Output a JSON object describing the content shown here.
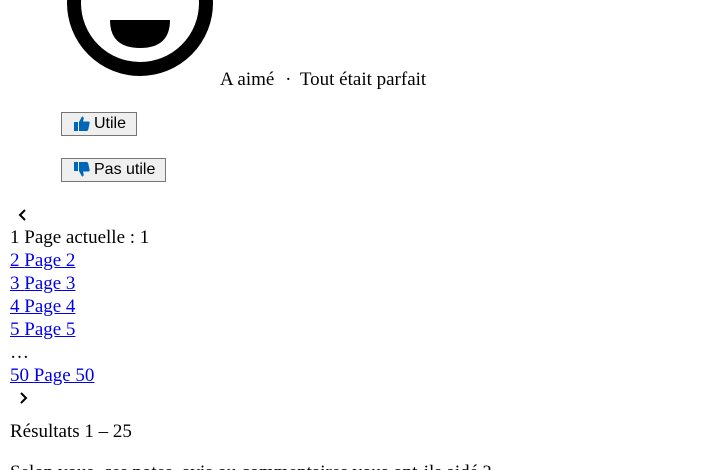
{
  "review": {
    "liked_label": "A aimé",
    "separator": "·",
    "comment": "Tout était parfait"
  },
  "votes": {
    "useful_label": "Utile",
    "not_useful_label": "Pas utile",
    "accent_color": "#0067b8"
  },
  "pagination": {
    "prev_icon": "chevron-left-icon",
    "next_icon": "chevron-right-icon",
    "current": {
      "number": "1",
      "label": "Page actuelle : 1"
    },
    "pages": [
      {
        "number": "2",
        "label": "Page 2"
      },
      {
        "number": "3",
        "label": "Page 3"
      },
      {
        "number": "4",
        "label": "Page 4"
      },
      {
        "number": "5",
        "label": "Page 5"
      }
    ],
    "ellipsis": "…",
    "last": {
      "number": "50",
      "label": "Page 50"
    },
    "results_text": "Résultats 1 – 25"
  },
  "footer": {
    "question": "Selon vous, ces notes, avis ou commentaires vous ont-ils aidé ?"
  }
}
